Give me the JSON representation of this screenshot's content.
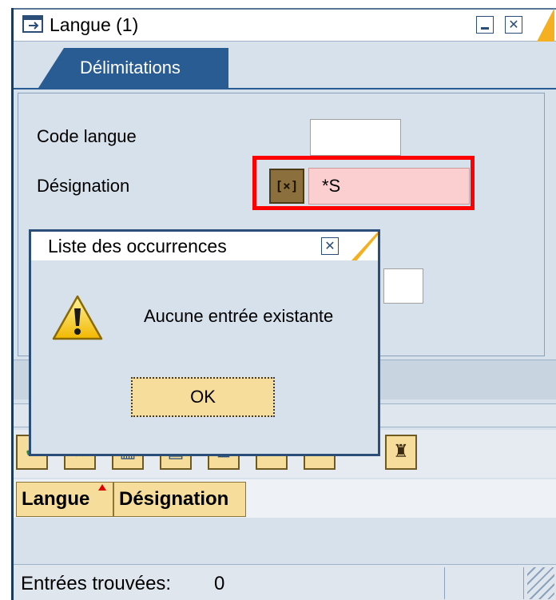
{
  "window": {
    "title": "Langue (1)",
    "minimize_glyph": "▁",
    "close_glyph": "✕",
    "tab_label": "Délimitations"
  },
  "form": {
    "code_langue_label": "Code langue",
    "code_langue_value": "",
    "designation_label": "Désignation",
    "designation_value": "*S",
    "select_icon": "[×]"
  },
  "table": {
    "columns": [
      "Langue",
      "Désignation"
    ]
  },
  "status": {
    "label": "Entrées trouvées:",
    "count": "0"
  },
  "dialog": {
    "title": "Liste des occurrences",
    "close_glyph": "✕",
    "message": "Aucune entrée existante",
    "ok_label": "OK"
  },
  "colors": {
    "accent": "#f4b020",
    "tab_blue": "#2a5c94",
    "error_field": "#fbcfcf",
    "highlight": "#ff0000"
  }
}
